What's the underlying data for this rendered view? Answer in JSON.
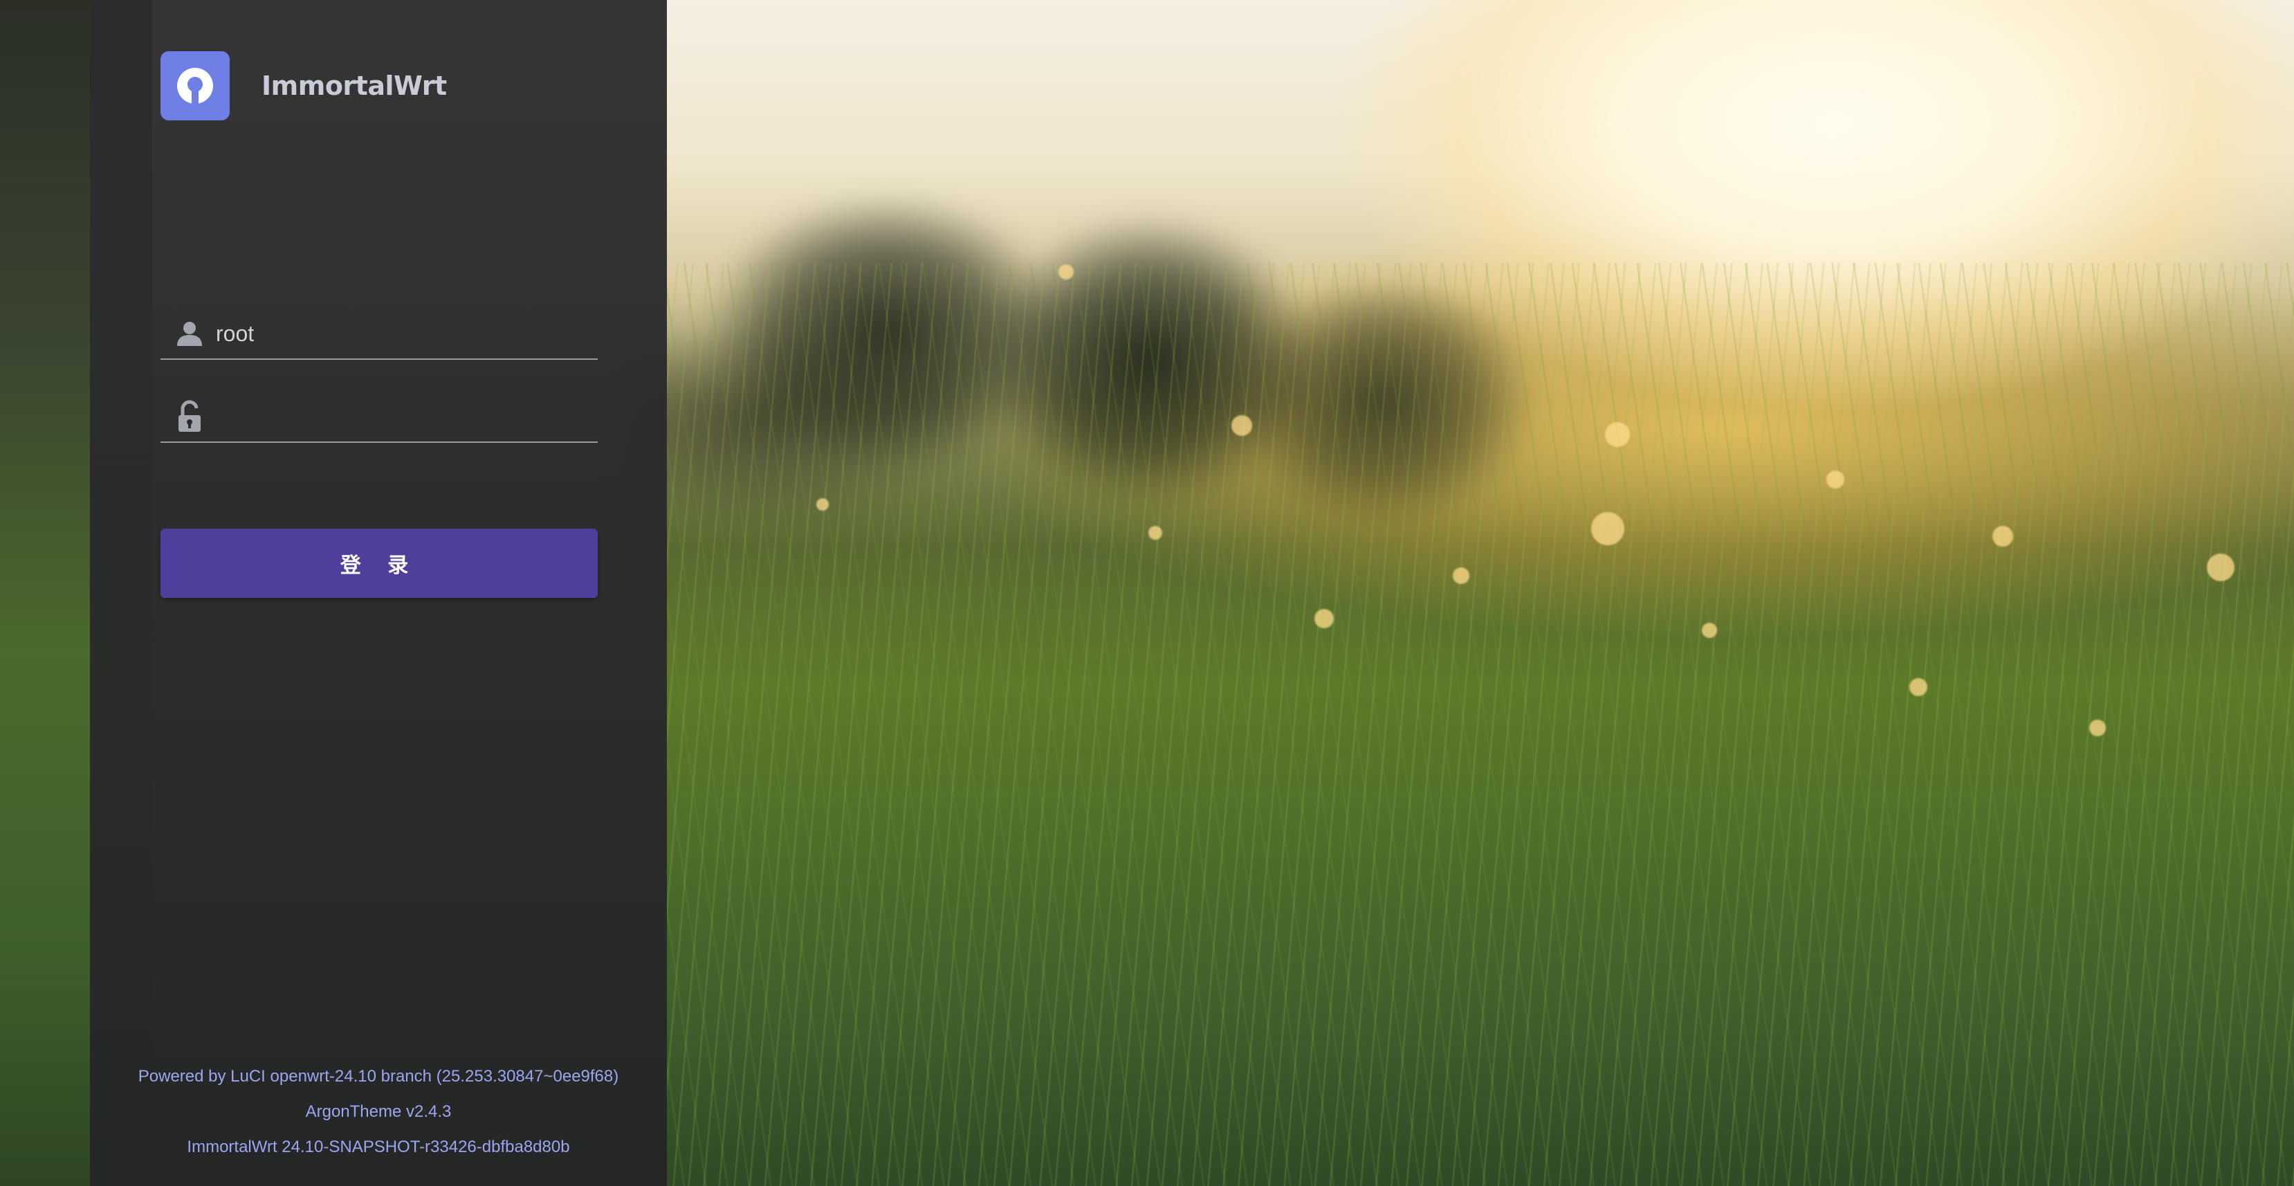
{
  "brand": {
    "name": "ImmortalWrt"
  },
  "login": {
    "username_value": "root",
    "password_value": "",
    "submit_label": "登 录"
  },
  "footer": {
    "line1": "Powered by LuCI openwrt-24.10 branch (25.253.30847~0ee9f68)",
    "line2": "ArgonTheme v2.4.3",
    "line3": "ImmortalWrt 24.10-SNAPSHOT-r33426-dbfba8d80b"
  },
  "colors": {
    "logo_bg": "#6f7fe6",
    "button_bg": "#503f9a",
    "footer_text": "#9aa6f0",
    "panel_bg": "#2c2c2e"
  },
  "icons": {
    "username": "user-icon",
    "password": "unlock-icon",
    "logo": "immortalwrt-logo-icon"
  }
}
